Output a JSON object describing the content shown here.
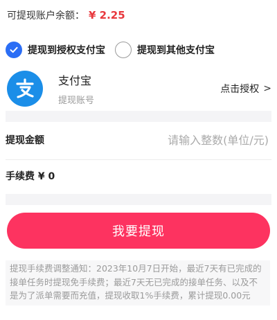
{
  "balance": {
    "label": "可提现账户余额：",
    "amount": "¥ 2.25"
  },
  "options": [
    {
      "label": "提现到授权支付宝",
      "checked": true
    },
    {
      "label": "提现到其他支付宝",
      "checked": false
    }
  ],
  "account": {
    "name": "支付宝",
    "subtitle": "提现账号",
    "authorize_label": "点击授权",
    "authorize_chevron": ">",
    "logo_icon": "alipay-logo"
  },
  "withdraw_amount": {
    "label": "提现金额",
    "placeholder": "请输入整数(单位/元)",
    "value": ""
  },
  "fee": {
    "label": "手续费 ¥ 0"
  },
  "submit_button": {
    "label": "我要提现"
  },
  "notice": {
    "text": "提现手续费调整通知：2023年10月7日开始，最近7天有已完成的接单任务时提现免手续费；最近7天无已完成的接单任务、以及不是为了派单需要而充值，提现收取1%手续费，累计提现0.00元"
  },
  "colors": {
    "accent_red": "#e8383d",
    "button_pink": "#fd3360",
    "radio_blue": "#2b6ef5",
    "alipay_blue": "#1b8ee8"
  }
}
